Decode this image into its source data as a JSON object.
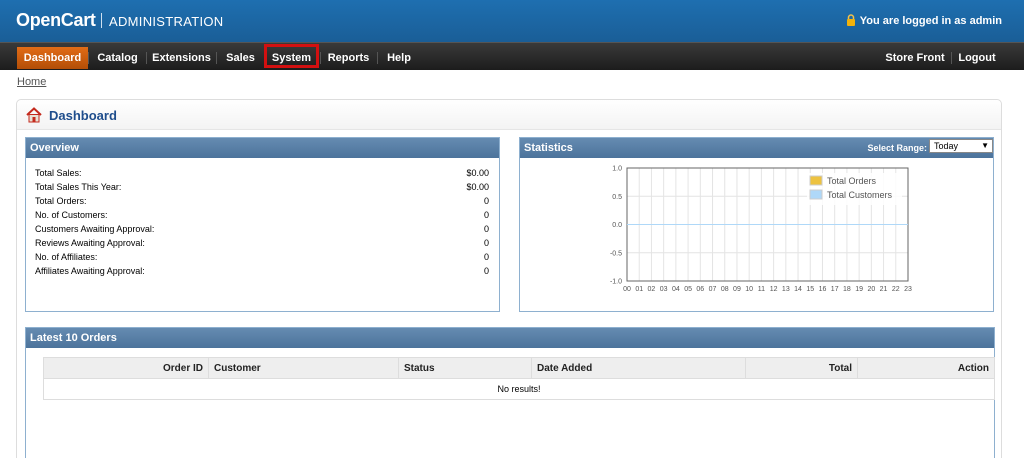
{
  "header": {
    "logo": "OpenCart",
    "subtitle": "ADMINISTRATION",
    "login_text": "You are logged in as admin"
  },
  "menu": {
    "items": [
      {
        "label": "Dashboard"
      },
      {
        "label": "Catalog"
      },
      {
        "label": "Extensions"
      },
      {
        "label": "Sales"
      },
      {
        "label": "System"
      },
      {
        "label": "Reports"
      },
      {
        "label": "Help"
      }
    ],
    "right": [
      {
        "label": "Store Front"
      },
      {
        "label": "Logout"
      }
    ]
  },
  "breadcrumb": "Home",
  "page_title": "Dashboard",
  "overview": {
    "title": "Overview",
    "rows": [
      {
        "label": "Total Sales:",
        "value": "$0.00"
      },
      {
        "label": "Total Sales This Year:",
        "value": "$0.00"
      },
      {
        "label": "Total Orders:",
        "value": "0"
      },
      {
        "label": "No. of Customers:",
        "value": "0"
      },
      {
        "label": "Customers Awaiting Approval:",
        "value": "0"
      },
      {
        "label": "Reviews Awaiting Approval:",
        "value": "0"
      },
      {
        "label": "No. of Affiliates:",
        "value": "0"
      },
      {
        "label": "Affiliates Awaiting Approval:",
        "value": "0"
      }
    ]
  },
  "statistics": {
    "title": "Statistics",
    "range_label": "Select Range:",
    "range_value": "Today",
    "y_ticks": [
      "1.0",
      "0.5",
      "0.0",
      "-0.5",
      "-1.0"
    ],
    "x_ticks": [
      "00",
      "01",
      "02",
      "03",
      "04",
      "05",
      "06",
      "07",
      "08",
      "09",
      "10",
      "11",
      "12",
      "13",
      "14",
      "15",
      "16",
      "17",
      "18",
      "19",
      "20",
      "21",
      "22",
      "23"
    ],
    "legend": [
      {
        "name": "Total Orders",
        "color": "#edc240"
      },
      {
        "name": "Total Customers",
        "color": "#afd8f8"
      }
    ]
  },
  "chart_data": {
    "type": "line",
    "x": [
      "00",
      "01",
      "02",
      "03",
      "04",
      "05",
      "06",
      "07",
      "08",
      "09",
      "10",
      "11",
      "12",
      "13",
      "14",
      "15",
      "16",
      "17",
      "18",
      "19",
      "20",
      "21",
      "22",
      "23"
    ],
    "series": [
      {
        "name": "Total Orders",
        "values": [
          0,
          0,
          0,
          0,
          0,
          0,
          0,
          0,
          0,
          0,
          0,
          0,
          0,
          0,
          0,
          0,
          0,
          0,
          0,
          0,
          0,
          0,
          0,
          0
        ]
      },
      {
        "name": "Total Customers",
        "values": [
          0,
          0,
          0,
          0,
          0,
          0,
          0,
          0,
          0,
          0,
          0,
          0,
          0,
          0,
          0,
          0,
          0,
          0,
          0,
          0,
          0,
          0,
          0,
          0
        ]
      }
    ],
    "ylim": [
      -1.0,
      1.0
    ],
    "grid": true,
    "legend_position": "top-right"
  },
  "orders": {
    "title": "Latest 10 Orders",
    "columns": [
      "Order ID",
      "Customer",
      "Status",
      "Date Added",
      "Total",
      "Action"
    ],
    "empty_text": "No results!"
  }
}
